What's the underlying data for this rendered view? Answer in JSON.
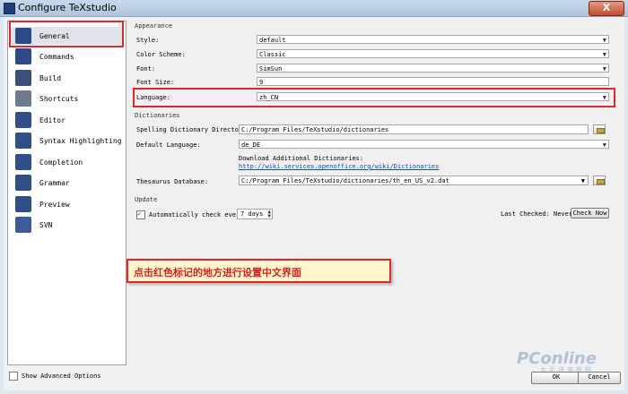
{
  "window": {
    "title": "Configure TeXstudio",
    "close_label": "X"
  },
  "sidebar": {
    "items": [
      {
        "label": "General",
        "icon": "general-icon"
      },
      {
        "label": "Commands",
        "icon": "commands-icon"
      },
      {
        "label": "Build",
        "icon": "build-icon"
      },
      {
        "label": "Shortcuts",
        "icon": "shortcuts-icon"
      },
      {
        "label": "Editor",
        "icon": "editor-icon"
      },
      {
        "label": "Syntax Highlighting",
        "icon": "syntax-icon"
      },
      {
        "label": "Completion",
        "icon": "completion-icon"
      },
      {
        "label": "Grammar",
        "icon": "grammar-icon"
      },
      {
        "label": "Preview",
        "icon": "preview-icon"
      },
      {
        "label": "SVN",
        "icon": "svn-icon"
      }
    ],
    "selected": "General",
    "show_advanced_label": "Show Advanced Options"
  },
  "appearance": {
    "title": "Appearance",
    "style_label": "Style:",
    "style_value": "default",
    "color_scheme_label": "Color Scheme:",
    "color_scheme_value": "Classic",
    "font_label": "Font:",
    "font_value": "SimSun",
    "font_size_label": "Font Size:",
    "font_size_value": "9",
    "language_label": "Language:",
    "language_value": "zh_CN"
  },
  "dictionaries": {
    "title": "Dictionaries",
    "spelling_dir_label": "Spelling Dictionary Directory:",
    "spelling_dir_value": "C:/Program Files/TeXstudio/dictionaries",
    "default_lang_label": "Default Language:",
    "default_lang_value": "de_DE",
    "download_text": "Download Additional Dictionaries:",
    "download_link": "http://wiki.services.openoffice.org/wiki/Dictionaries",
    "thesaurus_label": "Thesaurus Database:",
    "thesaurus_value": "C:/Program Files/TeXstudio/dictionaries/th_en_US_v2.dat"
  },
  "update": {
    "title": "Update",
    "auto_check_label": "Automatically check every",
    "interval_value": "7 days",
    "last_checked": "Last Checked: Never",
    "check_now": "Check Now"
  },
  "annotation": {
    "text": "点击红色标记的地方进行设置中文界面"
  },
  "watermark": {
    "brand": "PConline",
    "sub": "太平洋电脑网"
  },
  "buttons": {
    "ok": "OK",
    "cancel": "Cancel"
  },
  "colors": {
    "highlight_red": "#e2262b",
    "link_blue": "#0b4fc2",
    "window_bg": "#f0f0f0"
  }
}
